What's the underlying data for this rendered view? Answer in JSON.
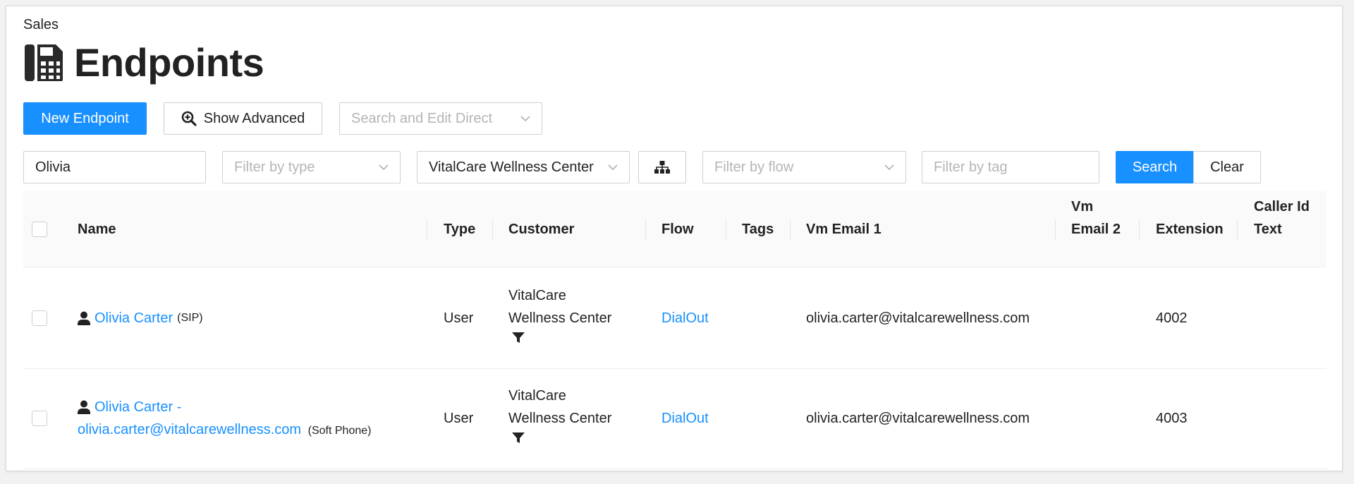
{
  "breadcrumb": "Sales",
  "page_title": "Endpoints",
  "toolbar": {
    "new_endpoint": "New Endpoint",
    "show_advanced": "Show Advanced",
    "search_edit_direct_placeholder": "Search and Edit Direct"
  },
  "filters": {
    "name_value": "Olivia",
    "type_placeholder": "Filter by type",
    "customer_value": "VitalCare Wellness Center",
    "flow_placeholder": "Filter by flow",
    "tag_placeholder": "Filter by tag",
    "search_label": "Search",
    "clear_label": "Clear"
  },
  "table": {
    "columns": {
      "name": "Name",
      "type": "Type",
      "customer": "Customer",
      "flow": "Flow",
      "tags": "Tags",
      "vm_email_1": "Vm Email 1",
      "vm_email_2_line1": "Vm",
      "vm_email_2_line2": "Email 2",
      "extension": "Extension",
      "caller_id_line1": "Caller Id",
      "caller_id_line2": "Text"
    },
    "rows": [
      {
        "name": "Olivia Carter",
        "name_suffix": "(SIP)",
        "type": "User",
        "customer_line1": "VitalCare",
        "customer_line2": "Wellness Center",
        "flow": "DialOut",
        "vm_email_1": "olivia.carter@vitalcarewellness.com",
        "extension": "4002"
      },
      {
        "name_line1": "Olivia Carter -",
        "name_line2": "olivia.carter@vitalcarewellness.com",
        "name_suffix": "(Soft Phone)",
        "type": "User",
        "customer_line1": "VitalCare",
        "customer_line2": "Wellness Center",
        "flow": "DialOut",
        "vm_email_1": "olivia.carter@vitalcarewellness.com",
        "extension": "4003"
      }
    ]
  },
  "colors": {
    "primary": "#1890ff",
    "text": "#222222",
    "placeholder": "#b5b5b5"
  },
  "icons": [
    "phone-fax-icon",
    "zoom-in-icon",
    "chevron-down-icon",
    "sitemap-icon",
    "user-icon",
    "filter-icon"
  ]
}
